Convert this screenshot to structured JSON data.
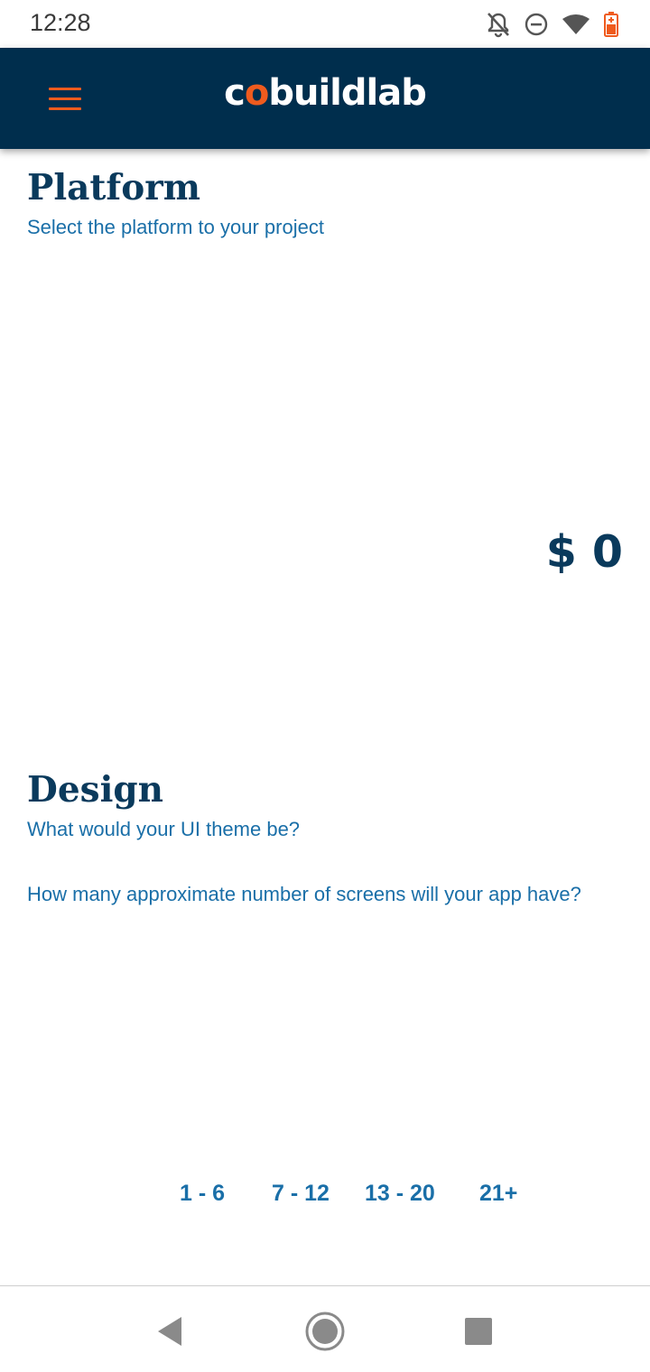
{
  "status_bar": {
    "time": "12:28",
    "icons": [
      "bell-off-icon",
      "do-not-disturb-icon",
      "wifi-icon",
      "battery-low-icon"
    ]
  },
  "header": {
    "logo": {
      "prefix": "c",
      "accent": "o",
      "suffix": "buildlab"
    },
    "menu_icon": "hamburger-menu-icon",
    "background_color": "#002e4d",
    "accent_color": "#ef5b1e"
  },
  "platform": {
    "title": "Platform",
    "subtitle": "Select the platform to your project"
  },
  "price": "$ 0",
  "design": {
    "title": "Design",
    "theme_question": "What would your UI theme be?",
    "screens_question": "How many approximate number of screens will your app have?",
    "screen_options": [
      "1 - 6",
      "7 - 12",
      "13 - 20",
      "21+"
    ]
  },
  "nav": {
    "icons": [
      "back-icon",
      "home-icon",
      "recents-icon"
    ]
  }
}
